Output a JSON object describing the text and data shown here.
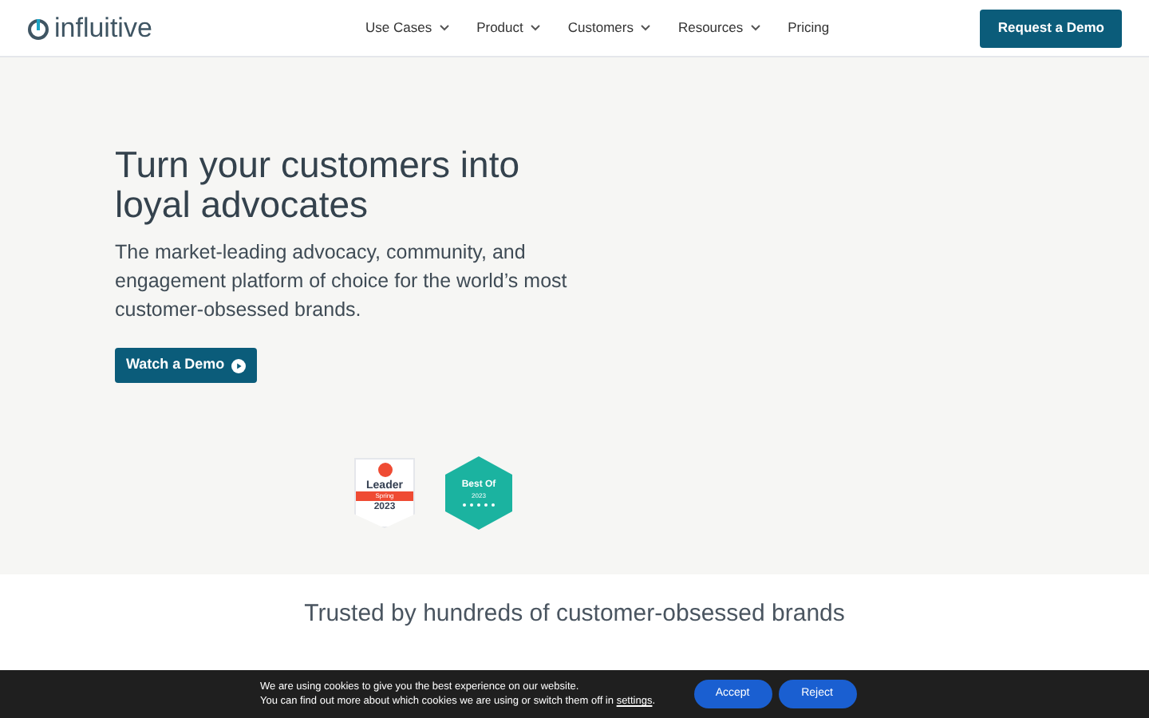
{
  "logo": {
    "text": "influitive"
  },
  "nav": {
    "items": [
      {
        "label": "Use Cases",
        "dropdown": true
      },
      {
        "label": "Product",
        "dropdown": true
      },
      {
        "label": "Customers",
        "dropdown": true
      },
      {
        "label": "Resources",
        "dropdown": true
      },
      {
        "label": "Pricing",
        "dropdown": false
      }
    ],
    "cta": "Request a Demo"
  },
  "hero": {
    "title": "Turn your customers into loyal advocates",
    "subtitle": "The market-leading advocacy, community, and engagement platform of choice for the world’s most customer-obsessed brands.",
    "button": "Watch a Demo",
    "badges": [
      {
        "kind": "g2",
        "title": "Leader",
        "ribbon": "Spring",
        "year": "2023"
      },
      {
        "kind": "trustradius",
        "title": "Best Of",
        "year": "2023"
      }
    ]
  },
  "trusted": {
    "heading": "Trusted by hundreds of customer-obsessed brands"
  },
  "cookie_bar": {
    "line_1": "We are using cookies to give you the best experience on our website.",
    "line_2": "You can find out more about which cookies we are using or switch them off in",
    "link": "settings",
    "end": ".",
    "buttons": [
      "Accept",
      "Reject"
    ]
  }
}
